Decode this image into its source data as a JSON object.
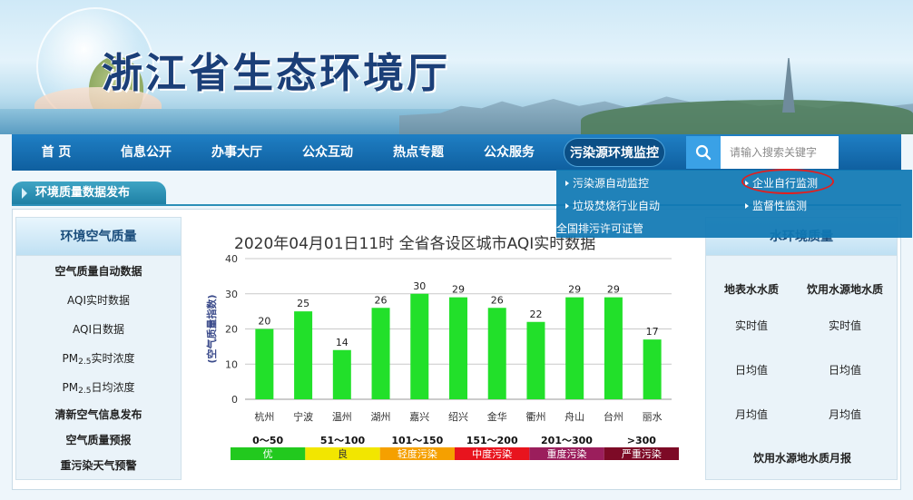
{
  "header": {
    "title": "浙江省生态环境厅"
  },
  "nav": {
    "items": [
      "首 页",
      "信息公开",
      "办事大厅",
      "公众互动",
      "热点专题",
      "公众服务",
      "污染源环境监控"
    ],
    "search_placeholder": "请输入搜索关键字"
  },
  "dropdown": {
    "items": [
      "污染源自动监控",
      "企业自行监测",
      "垃圾焚烧行业自动",
      "监督性监测",
      "全国排污许可证管"
    ]
  },
  "section": {
    "tab_label": "环境质量数据发布"
  },
  "left_panel": {
    "heading": "环境空气质量",
    "items": [
      {
        "label": "空气质量自动数据",
        "bold": true
      },
      {
        "label": "AQI实时数据",
        "bold": false
      },
      {
        "label": "AQI日数据",
        "bold": false
      },
      {
        "pre": "PM",
        "sub": "2.5",
        "post": "实时浓度"
      },
      {
        "pre": "PM",
        "sub": "2.5",
        "post": "日均浓度"
      },
      {
        "label": "清新空气信息发布",
        "bold": true
      },
      {
        "label": "空气质量预报",
        "bold": true
      },
      {
        "label": "重污染天气预警",
        "bold": true
      }
    ]
  },
  "right_panel": {
    "heading": "水环境质量",
    "col1": {
      "title": "地表水水质",
      "items": [
        "实时值",
        "日均值",
        "月均值"
      ]
    },
    "col2": {
      "title": "饮用水源地水质",
      "items": [
        "实时值",
        "日均值",
        "月均值"
      ]
    },
    "footer": "饮用水源地水质月报"
  },
  "chart_data": {
    "type": "bar",
    "title": "2020年04月01日11时 全省各设区城市AQI实时数据",
    "ylabel": "空气质量指数",
    "ylim": [
      0,
      40
    ],
    "yticks": [
      0,
      10,
      20,
      30,
      40
    ],
    "categories": [
      "杭州",
      "宁波",
      "温州",
      "湖州",
      "嘉兴",
      "绍兴",
      "金华",
      "衢州",
      "舟山",
      "台州",
      "丽水"
    ],
    "values": [
      20,
      25,
      14,
      26,
      30,
      29,
      26,
      22,
      29,
      29,
      17
    ],
    "bar_color": "#22e02a",
    "legend": [
      {
        "range": "0～50",
        "label": "优",
        "color": "#22c91e"
      },
      {
        "range": "51～100",
        "label": "良",
        "color": "#f2e600"
      },
      {
        "range": "101～150",
        "label": "轻度污染",
        "color": "#f5a000"
      },
      {
        "range": "151～200",
        "label": "中度污染",
        "color": "#e8141e"
      },
      {
        "range": "201～300",
        "label": "重度污染",
        "color": "#9b1e5c"
      },
      {
        "range": ">300",
        "label": "严重污染",
        "color": "#7d0a26"
      }
    ]
  }
}
